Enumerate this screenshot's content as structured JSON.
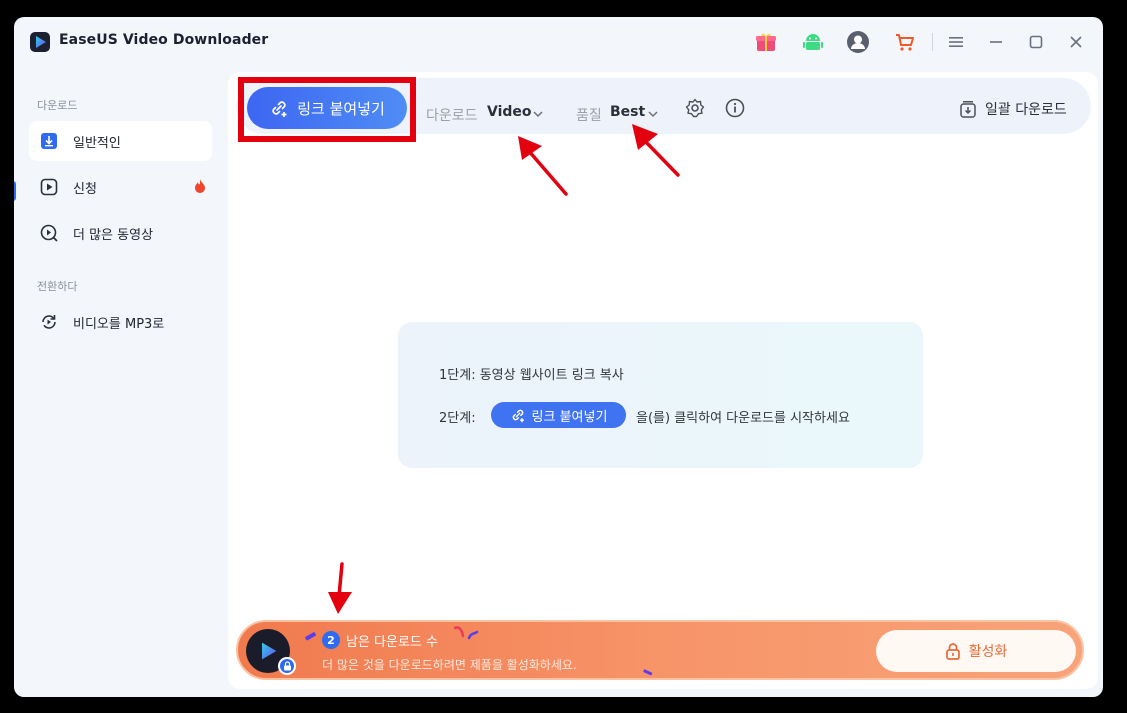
{
  "app": {
    "title": "EaseUS Video Downloader"
  },
  "sidebar": {
    "section_download": "다운로드",
    "section_convert": "전환하다",
    "items": [
      {
        "label": "일반적인",
        "icon": "download-box-icon"
      },
      {
        "label": "신청",
        "icon": "play-square-icon"
      },
      {
        "label": "더 많은 동영상",
        "icon": "play-search-icon"
      },
      {
        "label": "비디오를 MP3로",
        "icon": "convert-icon"
      }
    ]
  },
  "toolbar": {
    "paste_label": "링크 붙여넣기",
    "download_label": "다운로드",
    "download_value": "Video",
    "quality_label": "품질",
    "quality_value": "Best",
    "batch_label": "일괄 다운로드"
  },
  "steps": {
    "step1": "1단계: 동영상 웹사이트 링크 복사",
    "step2_prefix": "2단계:",
    "step2_button": "링크 붙여넣기",
    "step2_suffix": "을(를) 클릭하여 다운로드를 시작하세요"
  },
  "promo": {
    "count": "2",
    "title": "남은 다운로드 수",
    "subtitle": "더 많은 것을 다운로드하려면 제품을 활성화하세요.",
    "activate_label": "활성화"
  },
  "colors": {
    "accent": "#3d66f2",
    "promo": "#f07a4e",
    "annotation": "#e3000f"
  }
}
